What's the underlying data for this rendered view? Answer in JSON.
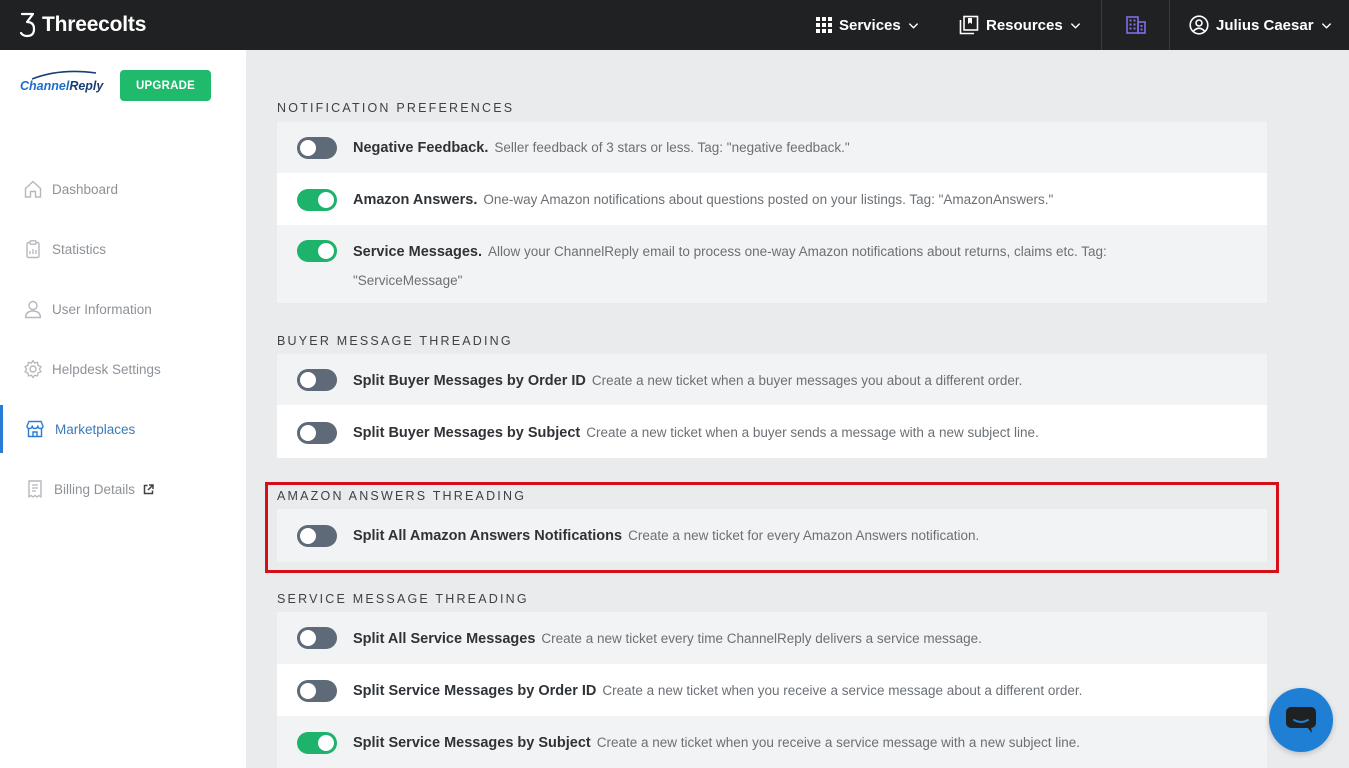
{
  "header": {
    "brand": "Threecolts",
    "services_label": "Services",
    "resources_label": "Resources",
    "user_name": "Julius Caesar"
  },
  "sidebar": {
    "logo_part1": "Channel",
    "logo_part2": "Reply",
    "upgrade_label": "UPGRADE",
    "items": [
      {
        "label": "Dashboard",
        "icon": "home-icon"
      },
      {
        "label": "Statistics",
        "icon": "clipboard-icon"
      },
      {
        "label": "User Information",
        "icon": "user-icon"
      },
      {
        "label": "Helpdesk Settings",
        "icon": "gear-icon"
      },
      {
        "label": "Marketplaces",
        "icon": "store-icon",
        "active": true
      },
      {
        "label": "Billing Details",
        "icon": "receipt-icon"
      }
    ]
  },
  "sections": [
    {
      "title": "NOTIFICATION PREFERENCES",
      "rows": [
        {
          "label": "Negative Feedback.",
          "desc": "Seller feedback of 3 stars or less. Tag: \"negative feedback.\"",
          "on": false
        },
        {
          "label": "Amazon Answers.",
          "desc": "One-way Amazon notifications about questions posted on your listings. Tag: \"AmazonAnswers.\"",
          "on": true
        },
        {
          "label": "Service Messages.",
          "desc": "Allow your ChannelReply email to process one-way Amazon notifications about returns, claims etc. Tag: \"ServiceMessage\"",
          "on": true
        }
      ]
    },
    {
      "title": "BUYER MESSAGE THREADING",
      "rows": [
        {
          "label": "Split Buyer Messages by Order ID",
          "desc": "Create a new ticket when a buyer messages you about a different order.",
          "on": false
        },
        {
          "label": "Split Buyer Messages by Subject",
          "desc": "Create a new ticket when a buyer sends a message with a new subject line.",
          "on": false
        }
      ]
    },
    {
      "title": "AMAZON ANSWERS THREADING",
      "rows": [
        {
          "label": "Split All Amazon Answers Notifications",
          "desc": "Create a new ticket for every Amazon Answers notification.",
          "on": false
        }
      ]
    },
    {
      "title": "SERVICE MESSAGE THREADING",
      "rows": [
        {
          "label": "Split All Service Messages",
          "desc": "Create a new ticket every time ChannelReply delivers a service message.",
          "on": false
        },
        {
          "label": "Split Service Messages by Order ID",
          "desc": "Create a new ticket when you receive a service message about a different order.",
          "on": false
        },
        {
          "label": "Split Service Messages by Subject",
          "desc": "Create a new ticket when you receive a service message with a new subject line.",
          "on": true
        }
      ]
    }
  ],
  "colors": {
    "toggle_on": "#1eb36b",
    "toggle_off": "#5f6a78",
    "highlight": "#d6101a",
    "accent": "#2a7bd6"
  }
}
